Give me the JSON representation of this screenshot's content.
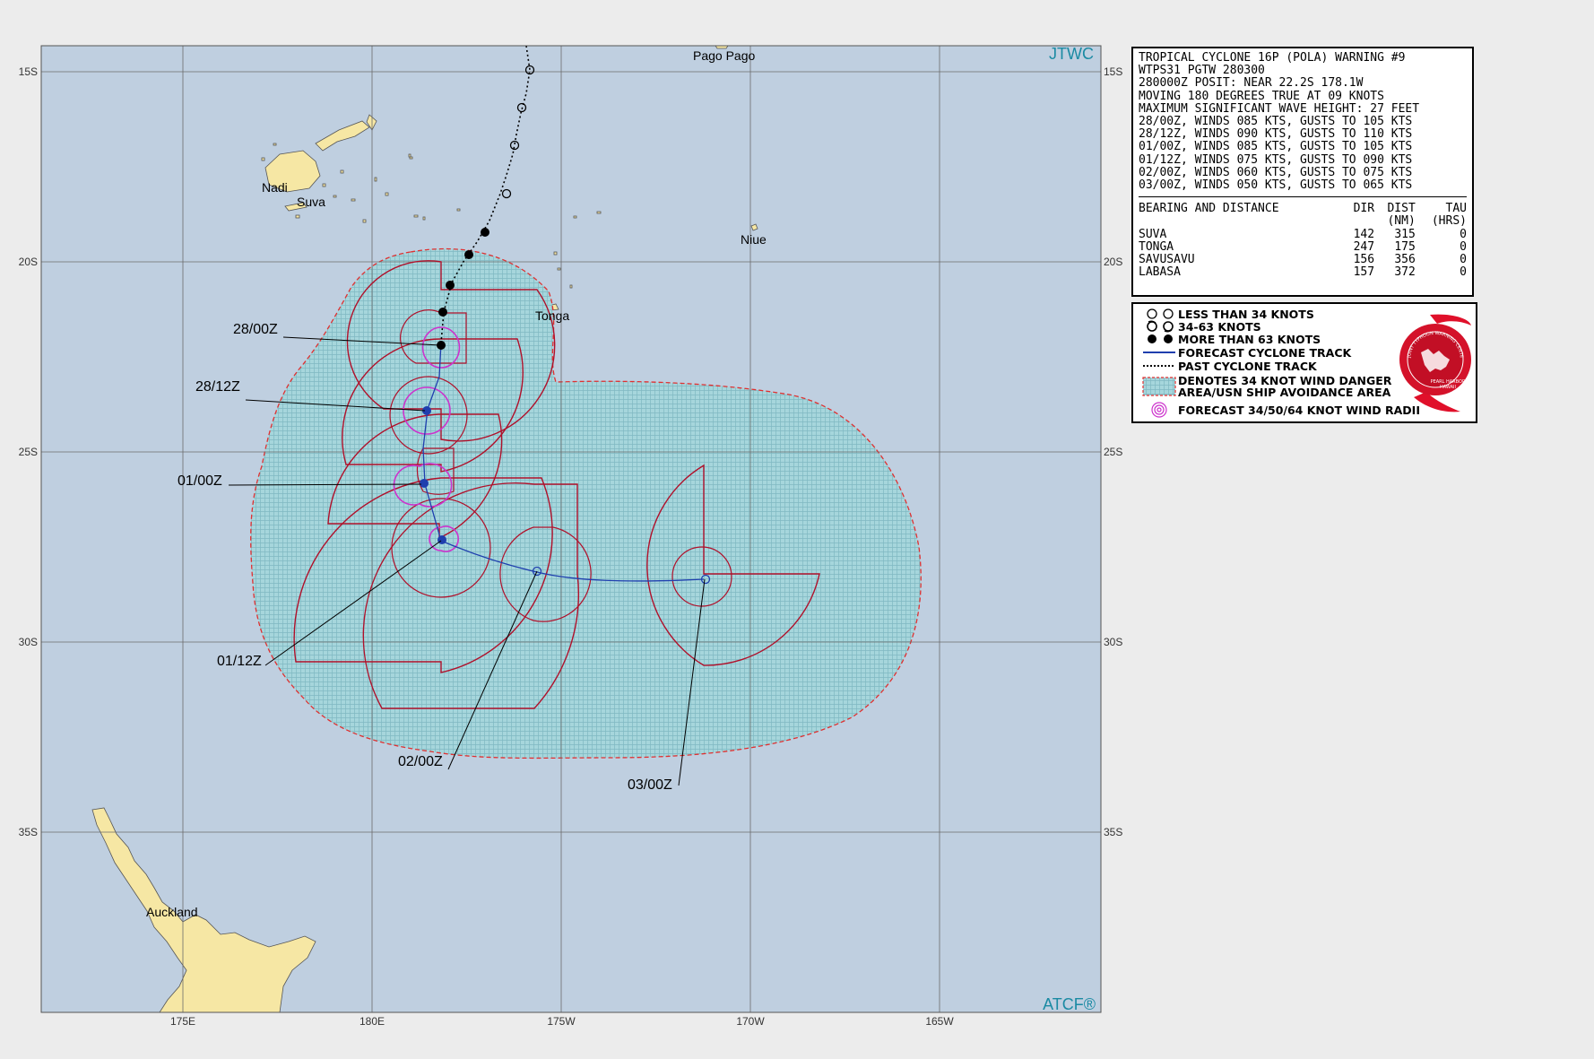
{
  "map": {
    "agency_label": "JTWC",
    "atcf_label": "ATCF®",
    "lat_labels": [
      "15S",
      "20S",
      "25S",
      "30S",
      "35S"
    ],
    "lon_labels": [
      "175E",
      "180E",
      "175W",
      "170W",
      "165W"
    ],
    "places": [
      "Pago Pago",
      "Nadi",
      "Suva",
      "Niue",
      "Tonga",
      "Auckland"
    ],
    "time_labels": [
      "28/00Z",
      "28/12Z",
      "01/00Z",
      "01/12Z",
      "02/00Z",
      "03/00Z"
    ],
    "colors": {
      "ocean": "#bfcfe0",
      "land": "#f6e7a4",
      "grid": "#6b6b6b",
      "danger_area": "#9dd0d7",
      "danger_border": "#e03030",
      "wind_radii_34": "#b0102a",
      "wind_radii_50_64": "#cc33cc",
      "forecast_track": "#1f3fae"
    }
  },
  "warning": {
    "lines": [
      "TROPICAL CYCLONE 16P (POLA) WARNING #9",
      "WTPS31 PGTW 280300",
      "280000Z POSIT: NEAR 22.2S 178.1W",
      "MOVING 180 DEGREES TRUE AT 09 KNOTS",
      "MAXIMUM SIGNIFICANT WAVE HEIGHT: 27 FEET",
      "28/00Z, WINDS 085 KTS, GUSTS TO 105 KTS",
      "28/12Z, WINDS 090 KTS, GUSTS TO 110 KTS",
      "01/00Z, WINDS 085 KTS, GUSTS TO 105 KTS",
      "01/12Z, WINDS 075 KTS, GUSTS TO 090 KTS",
      "02/00Z, WINDS 060 KTS, GUSTS TO 075 KTS",
      "03/00Z, WINDS 050 KTS, GUSTS TO 065 KTS"
    ],
    "bearing": {
      "header": [
        "BEARING AND DISTANCE",
        "DIR",
        "DIST",
        "TAU"
      ],
      "units": [
        "",
        "",
        "(NM)",
        "(HRS)"
      ],
      "rows": [
        [
          "SUVA",
          "142",
          "315",
          "0"
        ],
        [
          "TONGA",
          "247",
          "175",
          "0"
        ],
        [
          "SAVUSAVU",
          "156",
          "356",
          "0"
        ],
        [
          "LABASA",
          "157",
          "372",
          "0"
        ]
      ]
    }
  },
  "legend": {
    "items": [
      {
        "icon": "weak-storm-icon",
        "label": "LESS THAN 34 KNOTS"
      },
      {
        "icon": "tropical-storm-icon",
        "label": "34-63 KNOTS"
      },
      {
        "icon": "typhoon-icon",
        "label": "MORE THAN 63 KNOTS"
      },
      {
        "icon": "forecast-track-line-icon",
        "label": "FORECAST CYCLONE TRACK"
      },
      {
        "icon": "past-track-line-icon",
        "label": "PAST CYCLONE TRACK"
      },
      {
        "icon": "danger-area-swatch-icon",
        "label": "DENOTES 34 KNOT WIND DANGER\nAREA/USN SHIP AVOIDANCE AREA"
      },
      {
        "icon": "wind-radii-icon",
        "label": "FORECAST 34/50/64 KNOT WIND RADII"
      }
    ],
    "seal_text": [
      "JOINT TYPHOON WARNING CENTER",
      "PEARL HARBOR",
      "HAWAII"
    ]
  }
}
